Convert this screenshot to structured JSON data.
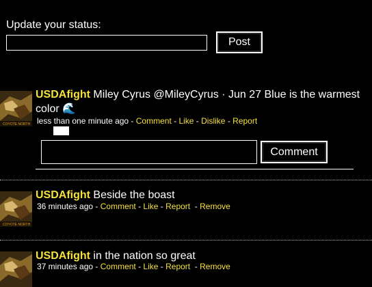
{
  "status": {
    "label": "Update your status:",
    "input_value": "",
    "post_label": "Post"
  },
  "posts": [
    {
      "author": "USDAfight",
      "text": " Miley Cyrus @MileyCyrus · Jun 27 Blue is the warmest",
      "text_line2": "color ",
      "emoji_icon": "wave-icon",
      "time": "less than one minute ago",
      "actions": [
        "Comment",
        "Like",
        "Dislike",
        "Report"
      ],
      "comment_input_value": "",
      "comment_button": "Comment"
    },
    {
      "author": "USDAfight",
      "text": " Beside the boast",
      "time": "36 minutes ago",
      "actions": [
        "Comment",
        "Like",
        "Report",
        "Remove"
      ]
    },
    {
      "author": "USDAfight",
      "text": " in the nation so great",
      "time": "37 minutes ago",
      "actions": [
        "Comment",
        "Like",
        "Report",
        "Remove"
      ]
    }
  ],
  "colors": {
    "link": "#f5e23a",
    "background": "#000000",
    "text": "#ffffff"
  }
}
